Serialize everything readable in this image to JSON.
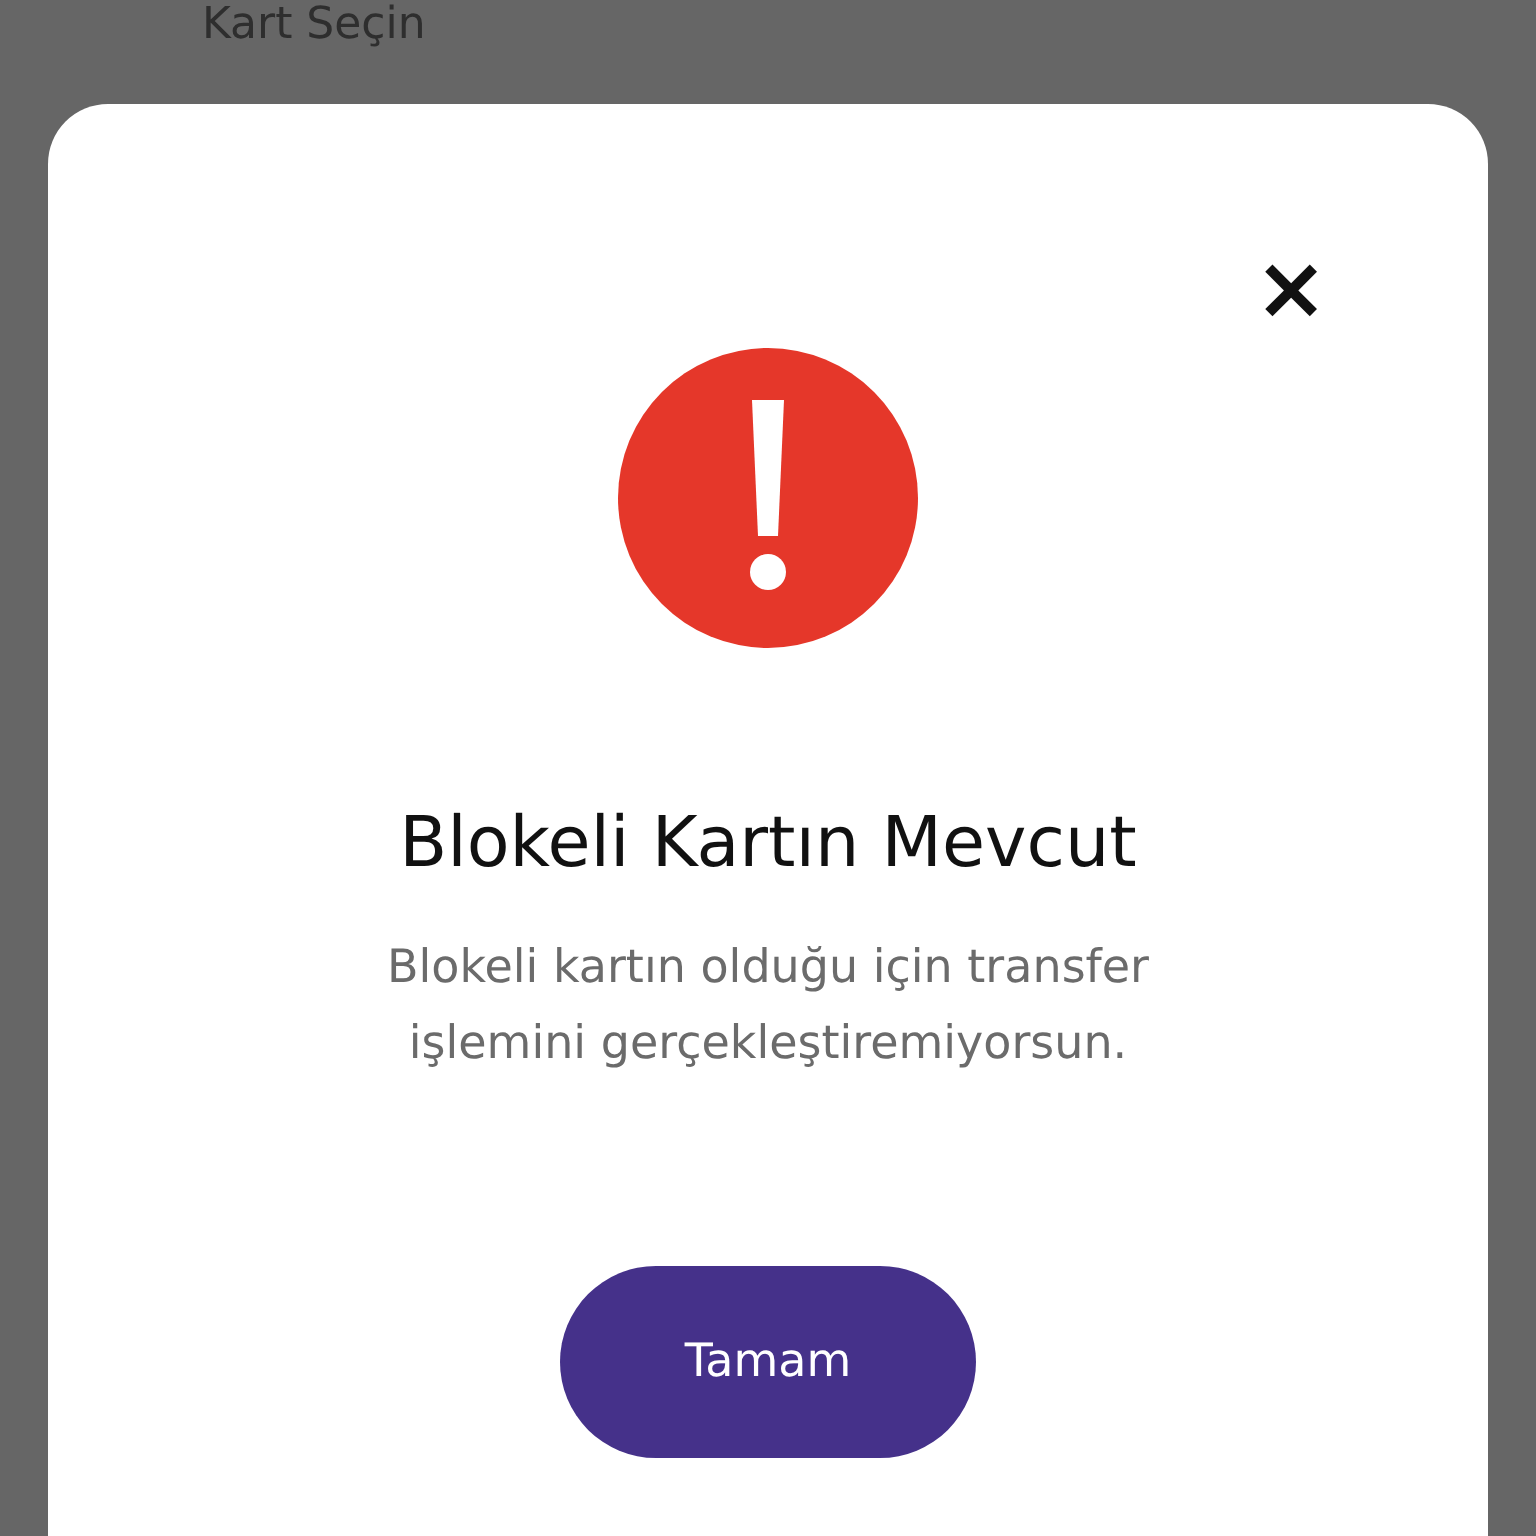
{
  "background": {
    "label": "Kart Seçin"
  },
  "dialog": {
    "close": "×",
    "title": "Blokeli Kartın Mevcut",
    "message": "Blokeli kartın olduğu için transfer işlemini gerçekleştiremiyorsun.",
    "button": "Tamam"
  }
}
